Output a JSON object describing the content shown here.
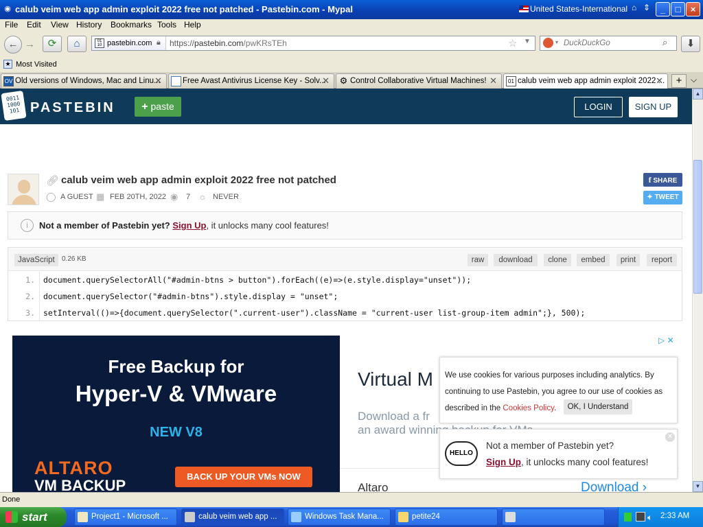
{
  "window": {
    "title": "calub veim web app admin exploit 2022 free not patched - Pastebin.com - Mypal",
    "language": "United States-International",
    "controls": [
      "_",
      "□",
      "×"
    ]
  },
  "menu": [
    "File",
    "Edit",
    "View",
    "History",
    "Bookmarks",
    "Tools",
    "Help"
  ],
  "nav": {
    "site_identity": "pastebin.com",
    "url_prefix": "https://",
    "url_host": "pastebin.com",
    "url_path": "/pwKRsTEh",
    "search_placeholder": "DuckDuckGo"
  },
  "bookmarks": {
    "most_visited": "Most Visited"
  },
  "tabs": [
    {
      "label": "Old versions of Windows, Mac and Linu...",
      "icon": "OV"
    },
    {
      "label": "Free Avast Antivirus License Key - Solv...",
      "icon": ""
    },
    {
      "label": "Control Collaborative Virtual Machines!",
      "icon": "⚙"
    },
    {
      "label": "calub veim web app admin exploit 2022 ...",
      "icon": "01"
    }
  ],
  "pastebin": {
    "brand": "PASTEBIN",
    "paste_button": "paste",
    "login": "LOGIN",
    "signup": "SIGN UP",
    "paste_title": "calub veim web app admin exploit 2022 free not patched",
    "author": "A GUEST",
    "date": "FEB 20TH, 2022",
    "views": "7",
    "expiry": "NEVER",
    "share": "SHARE",
    "tweet": "TWEET",
    "notice_bold": "Not a member of Pastebin yet?",
    "notice_link": "Sign Up",
    "notice_rest": ", it unlocks many cool features!",
    "syntax": "JavaScript",
    "size": "0.26 KB",
    "actions": [
      "raw",
      "download",
      "clone",
      "embed",
      "print",
      "report"
    ],
    "code": [
      {
        "n": "1.",
        "text": "document.querySelectorAll(\"#admin-btns > button\").forEach((e)=>(e.style.display=\"unset\"));"
      },
      {
        "n": "2.",
        "text": "document.querySelector(\"#admin-btns\").style.display = \"unset\";"
      },
      {
        "n": "3.",
        "text": "setInterval(()=>{document.querySelector(\".current-user\").className = \"current-user list-group-item admin\";}, 500);"
      }
    ]
  },
  "ad": {
    "headline1": "Free Backup for",
    "headline2": "Hyper-V & VMware",
    "new": "NEW V8",
    "brand1": "ALTARO",
    "brand2": "VM BACKUP",
    "cta": "BACK UP YOUR VMs NOW",
    "title_right": "Virtual M",
    "sub1": "Download a fr",
    "sub2": "an award winning backup for VMs",
    "advertiser": "Altaro",
    "download": "Download ›",
    "choice": "▷ ✕"
  },
  "cookie": {
    "text": "We use cookies for various purposes including analytics. By continuing to use Pastebin, you agree to our use of cookies as described in the",
    "link": "Cookies Policy",
    "period": ".",
    "ok": "OK, I Understand"
  },
  "hello_popup": {
    "hello": "HELLO",
    "line1": "Not a member of Pastebin yet?",
    "link": "Sign Up",
    "line2_rest": ", it unlocks many cool features!"
  },
  "status": "Done",
  "taskbar": {
    "start": "start",
    "tasks": [
      "Project1 - Microsoft ...",
      "calub veim web app ...",
      "Windows Task Mana...",
      "petite24"
    ],
    "clock": "2:33 AM"
  }
}
